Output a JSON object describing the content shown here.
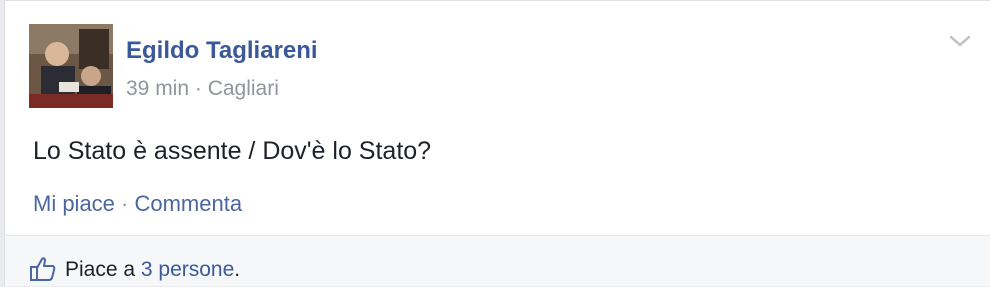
{
  "post": {
    "author": "Egildo Tagliareni",
    "time": "39 min",
    "separator": " · ",
    "location": "Cagliari",
    "text": "Lo Stato è assente / Dov'è lo Stato?"
  },
  "actions": {
    "like": "Mi piace",
    "separator": " · ",
    "comment": "Commenta"
  },
  "likes": {
    "prefix": "Piace a ",
    "count": "3 persone",
    "suffix": "."
  },
  "icons": {
    "menu": "chevron-down-icon",
    "like": "thumbs-up-icon"
  },
  "colors": {
    "link": "#3b5998",
    "meta": "#90949c",
    "background": "#ffffff",
    "footer": "#f6f7f9"
  }
}
